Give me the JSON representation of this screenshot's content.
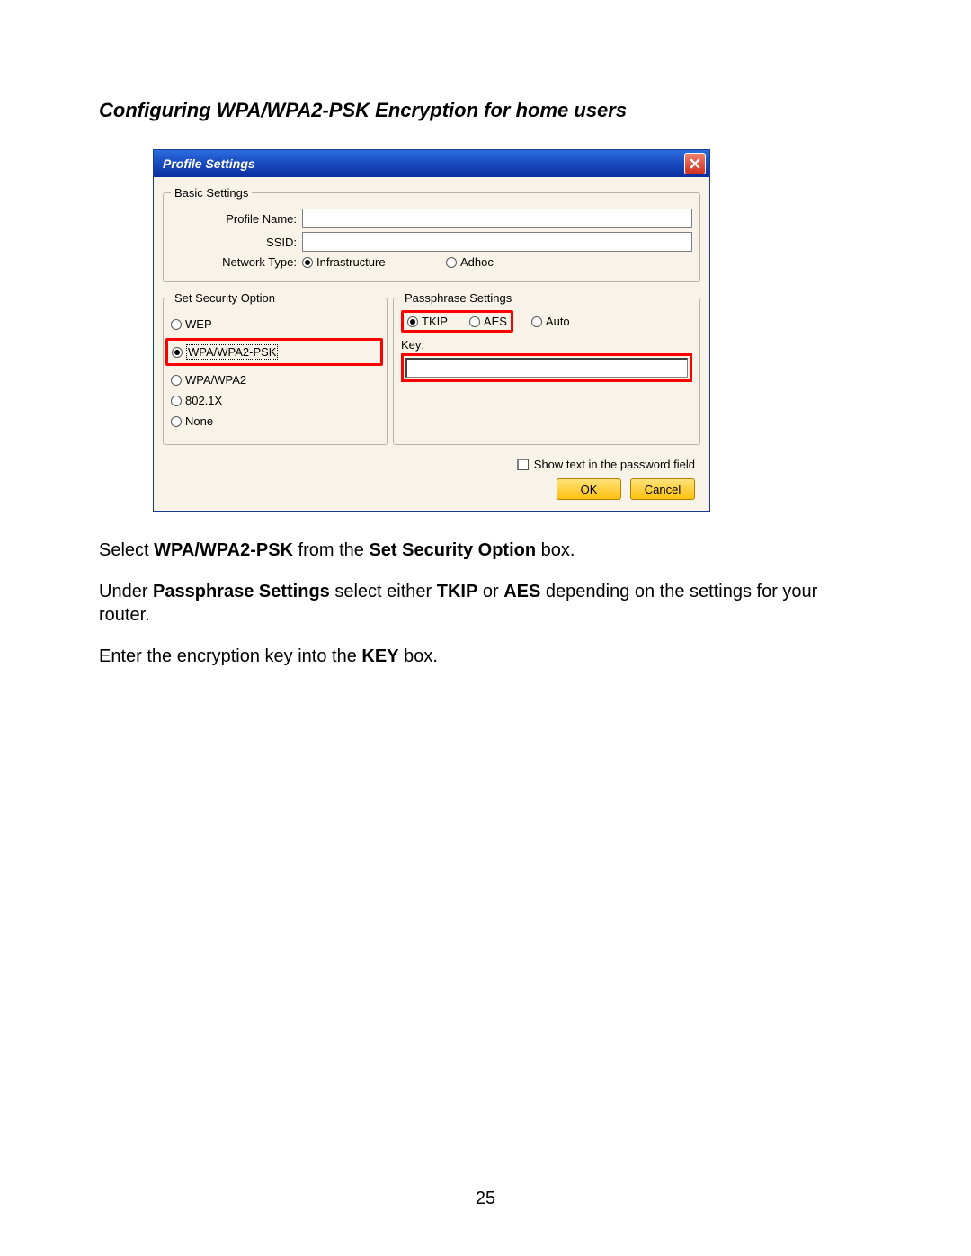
{
  "heading": "Configuring WPA/WPA2-PSK Encryption for home users",
  "dialog": {
    "title": "Profile Settings",
    "basic_legend": "Basic Settings",
    "profile_name_label": "Profile Name:",
    "profile_name_value": "",
    "ssid_label": "SSID:",
    "ssid_value": "",
    "network_type_label": "Network Type:",
    "nt_infra": "Infrastructure",
    "nt_adhoc": "Adhoc",
    "security_legend": "Set Security Option",
    "sec_wep": "WEP",
    "sec_wpa_psk": "WPA/WPA2-PSK",
    "sec_wpa": "WPA/WPA2",
    "sec_8021x": "802.1X",
    "sec_none": "None",
    "passphrase_legend": "Passphrase Settings",
    "enc_tkip": "TKIP",
    "enc_aes": "AES",
    "enc_auto": "Auto",
    "key_label": "Key:",
    "key_value": "",
    "show_text": "Show text in the password field",
    "ok": "OK",
    "cancel": "Cancel"
  },
  "para1_a": "Select ",
  "para1_b": "WPA/WPA2-PSK",
  "para1_c": " from the ",
  "para1_d": "Set Security Option",
  "para1_e": " box.",
  "para2_a": "Under ",
  "para2_b": "Passphrase Settings",
  "para2_c": " select either ",
  "para2_d": "TKIP",
  "para2_e": " or ",
  "para2_f": "AES",
  "para2_g": " depending on the settings for your router.",
  "para3_a": "Enter the encryption key into the ",
  "para3_b": "KEY",
  "para3_c": " box.",
  "page_number": "25"
}
